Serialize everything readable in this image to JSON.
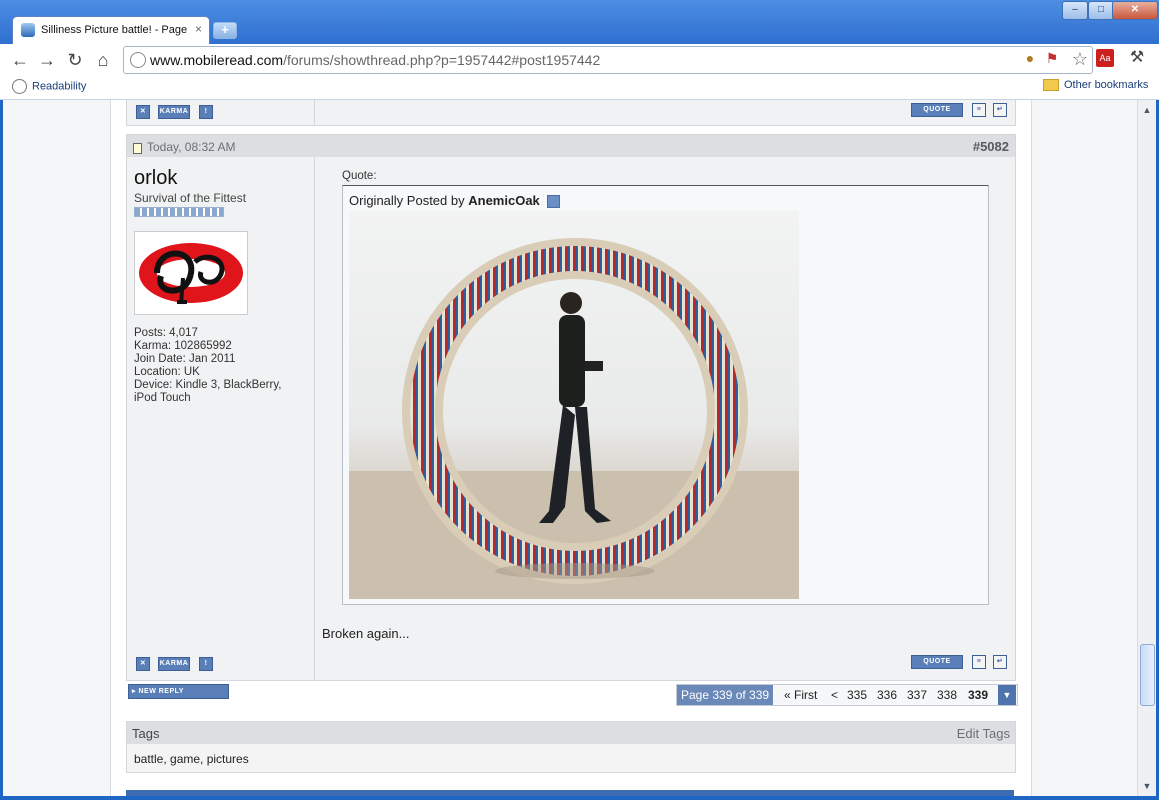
{
  "browser": {
    "tab_title": "Silliness Picture battle! - Page",
    "tab_close": "×",
    "new_tab": "+",
    "url_host": "www.mobileread.com",
    "url_path": "/forums/showthread.php?p=1957442#post1957442",
    "bookmarks": [
      {
        "label": "Readability"
      },
      {
        "label": "Other bookmarks"
      }
    ],
    "ext_pdf_label": "Aa"
  },
  "post_above": {
    "quote_label": "QUOTE",
    "karma_label": "KARMA"
  },
  "post": {
    "date": "Today, 08:32 AM",
    "number": "#5082",
    "user": {
      "name": "orlok",
      "title": "Survival of the Fittest",
      "stats": [
        "Posts: 4,017",
        "Karma: 102865992",
        "Join Date: Jan 2011",
        "Location: UK",
        "Device: Kindle 3, BlackBerry,",
        "iPod Touch"
      ]
    },
    "quote": {
      "label": "Quote:",
      "prefix": "Originally Posted by",
      "author": "AnemicOak"
    },
    "message": "Broken again...",
    "quote_label": "QUOTE",
    "karma_label": "KARMA"
  },
  "new_reply": "NEW REPLY",
  "pagination": {
    "label": "Page 339 of 339",
    "first": "« First",
    "prev": "<",
    "pages": [
      "335",
      "336",
      "337",
      "338"
    ],
    "current": "339"
  },
  "tags": {
    "title": "Tags",
    "edit": "Edit Tags",
    "list": "battle, game, pictures"
  }
}
